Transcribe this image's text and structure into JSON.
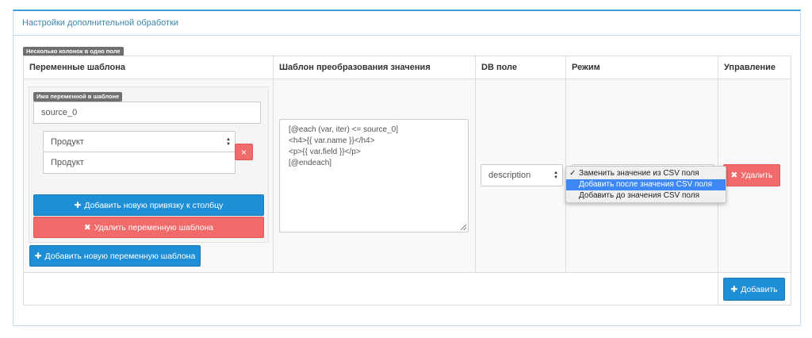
{
  "panel": {
    "title": "Настройки дополнительной обработки"
  },
  "badge_multi": "Несколько колонок в одно поле",
  "table": {
    "headers": [
      "Переменные шаблона",
      "Шаблон преобразования значения",
      "DB поле",
      "Режим",
      "Управление"
    ]
  },
  "variable": {
    "badge": "Имя переменной в шаблоне",
    "name_value": "source_0",
    "column_select_value": "Продукт",
    "column_dropdown_option": "Продукт",
    "remove_icon": "×",
    "add_binding_label": "Добавить новую привязку к столбцу",
    "delete_variable_label": "Удалить переменную шаблона"
  },
  "add_variable_label": "Добавить новую переменную шаблона",
  "template_lines": [
    "[@each (var, iter) <= source_0]",
    "<h4>{{ var.name }}</h4>",
    "<p>{{ var.field }}</p>",
    "[@endeach]"
  ],
  "db_field": {
    "value": "description"
  },
  "mode": {
    "options": [
      {
        "label": "Заменить значение из CSV поля",
        "checked": true,
        "highlighted": false
      },
      {
        "label": "Добавить после значения CSV поля",
        "checked": false,
        "highlighted": true
      },
      {
        "label": "Добавить до значения CSV поля",
        "checked": false,
        "highlighted": false
      }
    ]
  },
  "controls": {
    "delete_label": "Удалить",
    "add_label": "Добавить"
  },
  "icons": {
    "plus": "plus-icon",
    "times": "times-icon",
    "check": "check-icon"
  },
  "colors": {
    "primary": "#1e8fd6",
    "danger": "#f16b6b",
    "heading": "#3a87ad",
    "highlight": "#3d88f5"
  }
}
